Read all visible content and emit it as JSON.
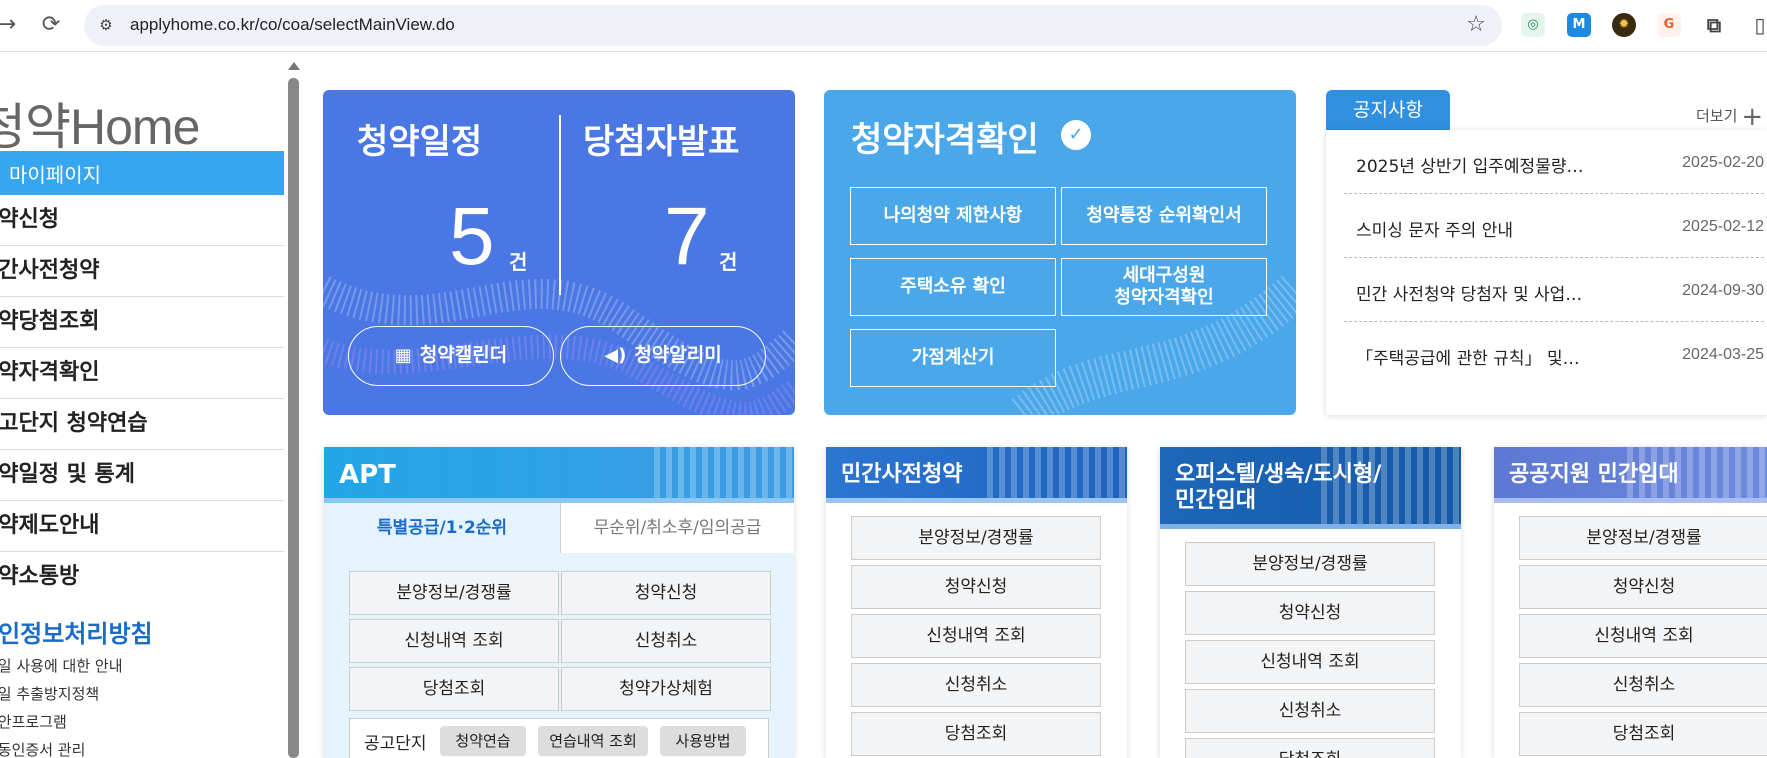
{
  "browser": {
    "url": "applyhome.co.kr/co/coa/selectMainView.do"
  },
  "sidebar": {
    "logo": "청약Home",
    "mypage": "마이페이지",
    "items": [
      {
        "label": "청약신청"
      },
      {
        "label": "민간사전청약"
      },
      {
        "label": "청약당첨조회"
      },
      {
        "label": "청약자격확인"
      },
      {
        "label": "공고단지 청약연습"
      },
      {
        "label": "청약일정 및 통계"
      },
      {
        "label": "청약제도안내"
      },
      {
        "label": "청약소통방"
      }
    ],
    "privacy": "개인정보처리방침",
    "sublinks": [
      {
        "label": "파일 사용에 대한 안내"
      },
      {
        "label": "파일 추출방지정책"
      },
      {
        "label": "보안프로그램"
      },
      {
        "label": "공동인증서 관리"
      }
    ]
  },
  "card1": {
    "left_title": "청약일정",
    "left_count": "5",
    "right_title": "당첨자발표",
    "right_count": "7",
    "unit": "건",
    "calendar_btn": "청약캘린더",
    "alarm_btn": "청약알리미"
  },
  "card2": {
    "title": "청약자격확인",
    "buttons": [
      {
        "label": "나의청약 제한사항"
      },
      {
        "label": "청약통장 순위확인서"
      },
      {
        "label": "주택소유 확인"
      },
      {
        "label": "세대구성원\n청약자격확인"
      },
      {
        "label": "가점계산기"
      }
    ]
  },
  "notice": {
    "tab": "공지사항",
    "more": "더보기",
    "rows": [
      {
        "title": "2025년 상반기 입주예정물량…",
        "date": "2025-02-20"
      },
      {
        "title": "스미싱 문자 주의 안내",
        "date": "2025-02-12"
      },
      {
        "title": "민간 사전청약 당첨자 및 사업…",
        "date": "2024-09-30"
      },
      {
        "title": "「주택공급에 관한 규칙」 및…",
        "date": "2024-03-25"
      }
    ]
  },
  "apt": {
    "title": "APT",
    "tab_active": "특별공급/1·2순위",
    "tab_other": "무순위/취소후/임의공급",
    "buttons": [
      {
        "label": "분양정보/경쟁률"
      },
      {
        "label": "청약신청"
      },
      {
        "label": "신청내역 조회"
      },
      {
        "label": "신청취소"
      },
      {
        "label": "당첨조회"
      },
      {
        "label": "청약가상체험"
      }
    ],
    "gonggo_label": "공고단지",
    "chips": [
      {
        "label": "청약연습"
      },
      {
        "label": "연습내역 조회"
      },
      {
        "label": "사용방법"
      }
    ]
  },
  "private_pre": {
    "title": "민간사전청약",
    "buttons": [
      {
        "label": "분양정보/경쟁률"
      },
      {
        "label": "청약신청"
      },
      {
        "label": "신청내역 조회"
      },
      {
        "label": "신청취소"
      },
      {
        "label": "당첨조회"
      }
    ]
  },
  "officetel": {
    "title": "오피스텔/생숙/도시형/\n민간임대",
    "buttons": [
      {
        "label": "분양정보/경쟁률"
      },
      {
        "label": "청약신청"
      },
      {
        "label": "신청내역 조회"
      },
      {
        "label": "신청취소"
      },
      {
        "label": "당첨조회"
      }
    ]
  },
  "public_rental": {
    "title": "공공지원 민간임대",
    "buttons": [
      {
        "label": "분양정보/경쟁률"
      },
      {
        "label": "청약신청"
      },
      {
        "label": "신청내역 조회"
      },
      {
        "label": "신청취소"
      },
      {
        "label": "당첨조회"
      }
    ]
  },
  "colors": {
    "card1_bg": "#4a77e4",
    "card2_bg": "#4aa7ea",
    "mypage_bg": "#36a6f0",
    "notice_tab": "#2f8fe0",
    "privacy_text": "#1b6cc9"
  }
}
